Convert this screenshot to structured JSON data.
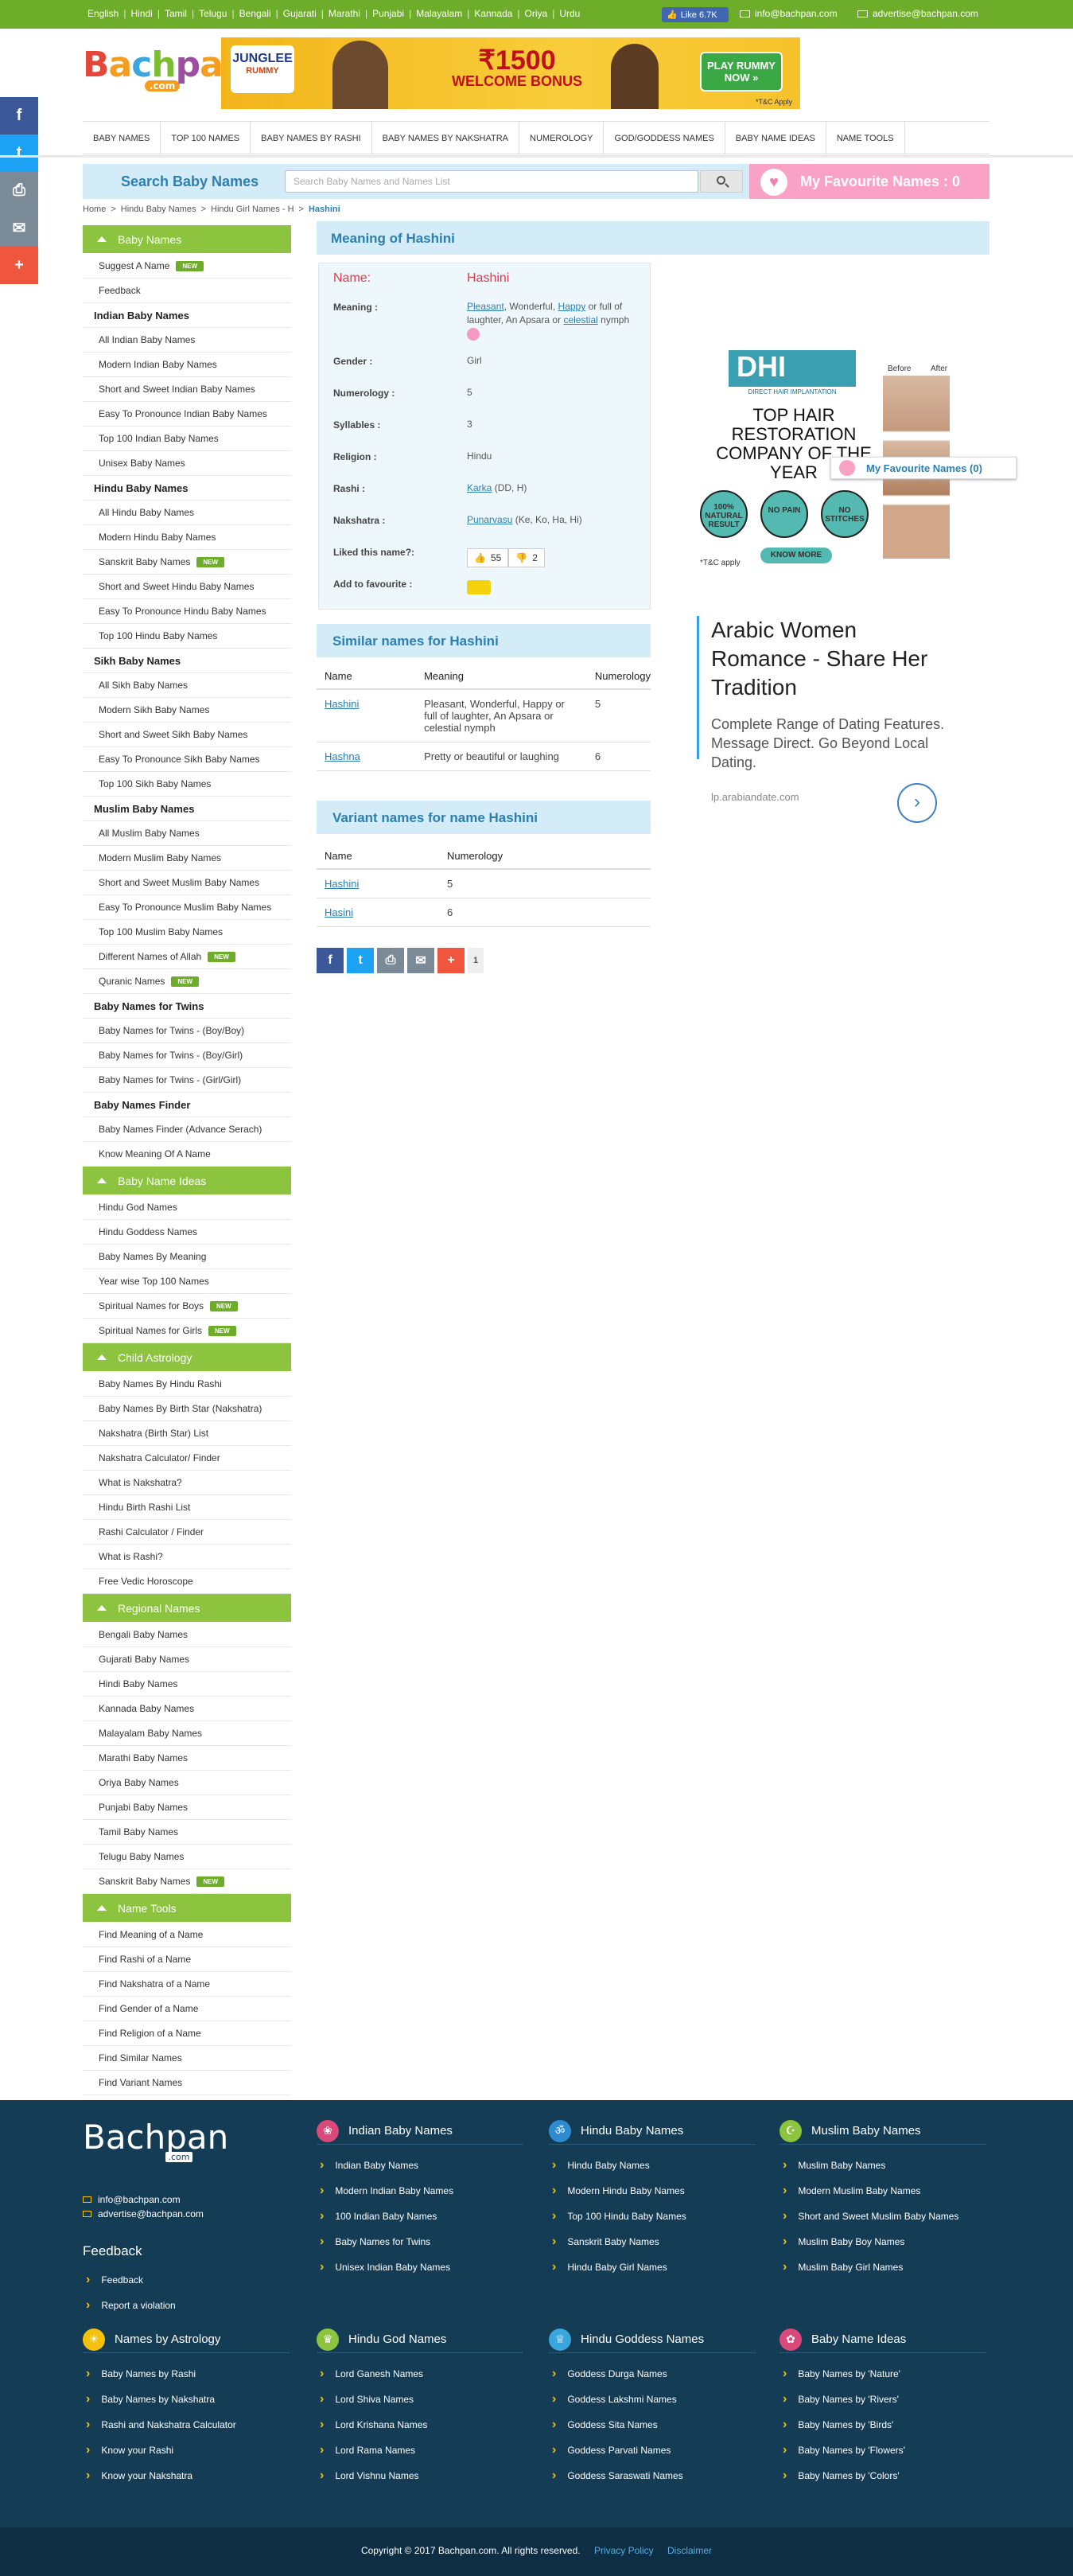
{
  "languages": [
    "English",
    "Hindi",
    "Tamil",
    "Telugu",
    "Bengali",
    "Gujarati",
    "Marathi",
    "Punjabi",
    "Malayalam",
    "Kannada",
    "Oriya",
    "Urdu"
  ],
  "fb_like": "Like 6.7K",
  "top_emails": [
    "info@bachpan.com",
    "advertise@bachpan.com"
  ],
  "logo": {
    "brand": "Bachpan",
    "sub": ".com"
  },
  "ad_banner": {
    "brand": "JUNGLEE",
    "brand2": "RUMMY",
    "amount": "₹1500",
    "bonus": "WELCOME BONUS",
    "cta": "PLAY RUMMY NOW »",
    "tc": "*T&C Apply"
  },
  "nav": [
    "BABY NAMES",
    "TOP 100 NAMES",
    "BABY NAMES BY RASHI",
    "BABY NAMES BY NAKSHATRA",
    "NUMEROLOGY",
    "GOD/GODDESS NAMES",
    "BABY NAME IDEAS",
    "NAME TOOLS"
  ],
  "search": {
    "title": "Search Baby Names",
    "placeholder": "Search Baby Names and Names List",
    "fav": "My Favourite Names : 0"
  },
  "breadcrumb": [
    "Home",
    ">",
    "Hindu Baby Names",
    ">",
    "Hindu Girl Names - H",
    ">",
    "Hashini"
  ],
  "sidebar": {
    "s1": {
      "head": "Baby Names",
      "items": [
        "Suggest A Name",
        "Feedback"
      ],
      "indian": {
        "title": "Indian Baby Names",
        "items": [
          "All Indian Baby Names",
          "Modern Indian Baby Names",
          "Short and Sweet Indian Baby Names",
          "Easy To Pronounce Indian Baby Names",
          "Top 100 Indian Baby Names",
          "Unisex Baby Names"
        ]
      },
      "hindu": {
        "title": "Hindu Baby Names",
        "items": [
          "All Hindu Baby Names",
          "Modern Hindu Baby Names",
          "Sanskrit Baby Names",
          "Short and Sweet Hindu Baby Names",
          "Easy To Pronounce Hindu Baby Names",
          "Top 100 Hindu Baby Names"
        ]
      },
      "sikh": {
        "title": "Sikh Baby Names",
        "items": [
          "All Sikh Baby Names",
          "Modern Sikh Baby Names",
          "Short and Sweet Sikh Baby Names",
          "Easy To Pronounce Sikh Baby Names",
          "Top 100 Sikh Baby Names"
        ]
      },
      "muslim": {
        "title": "Muslim Baby Names",
        "items": [
          "All Muslim Baby Names",
          "Modern Muslim Baby Names",
          "Short and Sweet Muslim Baby Names",
          "Easy To Pronounce Muslim Baby Names",
          "Top 100 Muslim Baby Names",
          "Different Names of Allah",
          "Quranic Names"
        ]
      },
      "twins": {
        "title": "Baby Names for Twins",
        "items": [
          "Baby Names for Twins - (Boy/Boy)",
          "Baby Names for Twins - (Boy/Girl)",
          "Baby Names for Twins - (Girl/Girl)"
        ]
      },
      "finder": {
        "title": "Baby Names Finder",
        "items": [
          "Baby Names Finder (Advance Serach)",
          "Know Meaning Of A Name"
        ]
      }
    },
    "new": "NEW",
    "s2": {
      "head": "Baby Name Ideas",
      "items": [
        "Hindu God Names",
        "Hindu Goddess Names",
        "Baby Names By Meaning",
        "Year wise Top 100 Names",
        "Spiritual Names for Boys",
        "Spiritual Names for Girls"
      ]
    },
    "s3": {
      "head": "Child Astrology",
      "items": [
        "Baby Names By Hindu Rashi",
        "Baby Names By Birth Star (Nakshatra)",
        "Nakshatra (Birth Star) List",
        "Nakshatra Calculator/ Finder",
        "What is Nakshatra?",
        "Hindu Birth Rashi List",
        "Rashi Calculator / Finder",
        "What is Rashi?",
        "Free Vedic Horoscope"
      ]
    },
    "s4": {
      "head": "Regional Names",
      "items": [
        "Bengali Baby Names",
        "Gujarati Baby Names",
        "Hindi Baby Names",
        "Kannada Baby Names",
        "Malayalam Baby Names",
        "Marathi Baby Names",
        "Oriya Baby Names",
        "Punjabi Baby Names",
        "Tamil Baby Names",
        "Telugu Baby Names",
        "Sanskrit Baby Names"
      ]
    },
    "s5": {
      "head": "Name Tools",
      "items": [
        "Find Meaning of a Name",
        "Find Rashi of a Name",
        "Find Nakshatra of a Name",
        "Find Gender of a Name",
        "Find Religion of a Name",
        "Find Similar Names",
        "Find Variant Names"
      ]
    }
  },
  "meaning": {
    "heading": "Meaning of Hashini",
    "name_label": "Name:",
    "name": "Hashini",
    "meaning_label": "Meaning :",
    "meaning_links": [
      "Pleasant",
      "Happy",
      "celestial"
    ],
    "meaning_text": [
      "Wonderful,",
      "or full of laughter, An Apsara or",
      "nymph"
    ],
    "gender_label": "Gender :",
    "gender": "Girl",
    "numerology_label": "Numerology :",
    "numerology": "5",
    "syllables_label": "Syllables :",
    "syllables": "3",
    "religion_label": "Religion :",
    "religion": "Hindu",
    "rashi_label": "Rashi :",
    "rashi": "Karka",
    "rashi_letters": "(DD, H)",
    "nakshatra_label": "Nakshatra :",
    "nakshatra": "Punarvasu",
    "nakshatra_letters": "(Ke, Ko, Ha, Hi)",
    "liked_label": "Liked this name?:",
    "likes": "55",
    "dislikes": "2",
    "fav_label": "Add to favourite :"
  },
  "similar": {
    "heading": "Similar names for Hashini",
    "cols": [
      "Name",
      "Meaning",
      "Numerology"
    ],
    "rows": [
      {
        "name": "Hashini",
        "meaning": "Pleasant, Wonderful, Happy or full of laughter, An Apsara or celestial nymph",
        "num": "5"
      },
      {
        "name": "Hashna",
        "meaning": "Pretty or beautiful or laughing",
        "num": "6"
      }
    ]
  },
  "variant": {
    "heading": "Variant names for name Hashini",
    "cols": [
      "Name",
      "Numerology"
    ],
    "rows": [
      {
        "name": "Hashini",
        "num": "5"
      },
      {
        "name": "Hasini",
        "num": "6"
      }
    ]
  },
  "share_count": "1",
  "ad_dhi": {
    "logo": "DHI",
    "sub": "DIRECT HAIR IMPLANTATION",
    "before": "Before",
    "after": "After",
    "headline": "TOP HAIR RESTORATION COMPANY OF THE YEAR",
    "badges": [
      "100% NATURAL RESULT",
      "NO PAIN",
      "NO STITCHES"
    ],
    "cta": "KNOW MORE",
    "tc": "*T&C apply"
  },
  "fav_float": "My Favourite Names (0)",
  "ad_dating": {
    "headline": "Arabic Women Romance - Share Her Tradition",
    "body": "Complete Range of Dating Features. Message Direct. Go Beyond Local Dating.",
    "url": "lp.arabiandate.com"
  },
  "footer": {
    "logo": "Bachpan",
    "logo_sub": ".com",
    "emails": [
      "info@bachpan.com",
      "advertise@bachpan.com"
    ],
    "feedback_head": "Feedback",
    "feedback_items": [
      "Feedback",
      "Report a violation"
    ],
    "cols": [
      {
        "title": "Indian Baby Names",
        "items": [
          "Indian Baby Names",
          "Modern Indian Baby Names",
          "100 Indian Baby Names",
          "Baby Names for Twins",
          "Unisex Indian Baby Names"
        ]
      },
      {
        "title": "Hindu Baby Names",
        "items": [
          "Hindu Baby Names",
          "Modern Hindu Baby Names",
          "Top 100 Hindu Baby Names",
          "Sanskrit Baby Names",
          "Hindu Baby Girl Names"
        ]
      },
      {
        "title": "Muslim Baby Names",
        "items": [
          "Muslim Baby Names",
          "Modern Muslim Baby Names",
          "Short and Sweet Muslim Baby Names",
          "Muslim Baby Boy Names",
          "Muslim Baby Girl Names"
        ]
      },
      {
        "title": "Names by Astrology",
        "items": [
          "Baby Names by Rashi",
          "Baby Names by Nakshatra",
          "Rashi and Nakshatra Calculator",
          "Know your Rashi",
          "Know your Nakshatra"
        ]
      },
      {
        "title": "Hindu God Names",
        "items": [
          "Lord Ganesh Names",
          "Lord Shiva Names",
          "Lord Krishana Names",
          "Lord Rama Names",
          "Lord Vishnu Names"
        ]
      },
      {
        "title": "Hindu Goddess Names",
        "items": [
          "Goddess Durga Names",
          "Goddess Lakshmi Names",
          "Goddess Sita Names",
          "Goddess Parvati Names",
          "Goddess Saraswati Names"
        ]
      },
      {
        "title": "Baby Name Ideas",
        "items": [
          "Baby Names by 'Nature'",
          "Baby Names by 'Rivers'",
          "Baby Names by 'Birds'",
          "Baby Names by 'Flowers'",
          "Baby Names by 'Colors'"
        ]
      }
    ],
    "copyright": "Copyright © 2017 Bachpan.com. All rights reserved.",
    "links": [
      "Privacy Policy",
      "Disclaimer"
    ]
  },
  "colors": {
    "green": "#6ead2a",
    "sidebar_green": "#8cc43f",
    "blue": "#2c7fb0",
    "light_blue": "#d3ecf8",
    "pink": "#f9a2c6",
    "footer": "#143c55"
  }
}
